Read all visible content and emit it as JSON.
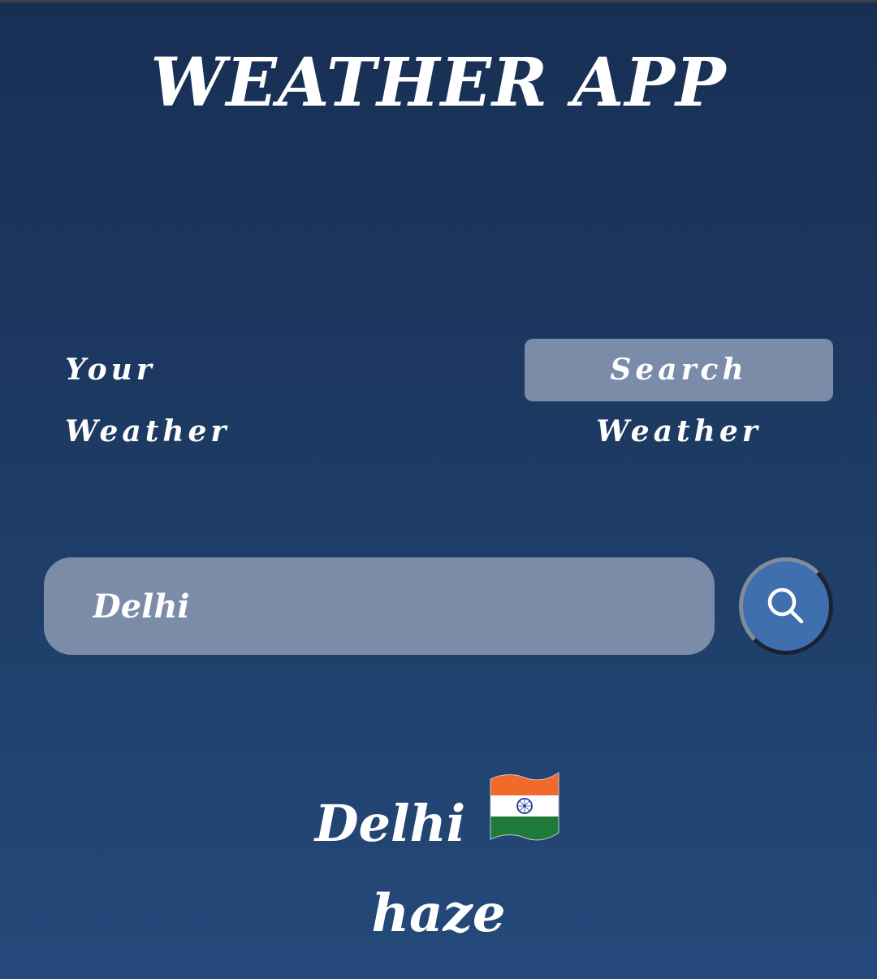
{
  "app": {
    "title": "WEATHER APP"
  },
  "tabs": [
    {
      "label": "Your Weather",
      "active": false
    },
    {
      "label": "Search Weather",
      "active": true
    }
  ],
  "search": {
    "value": "Delhi",
    "button_icon": "search-icon"
  },
  "weather": {
    "city": "Delhi",
    "flag_icon": "india-flag-icon",
    "condition": "haze"
  },
  "colors": {
    "background_top": "#182f54",
    "background_bottom": "#24497a",
    "active_tab": "#7a8ca8",
    "search_field": "#7a8ca8",
    "search_button": "#3f6fae"
  }
}
